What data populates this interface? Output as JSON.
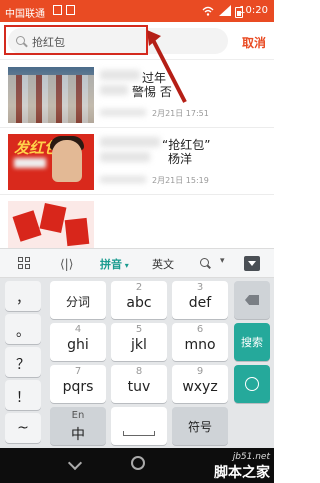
{
  "status_bar": {
    "carrier": "中国联通",
    "time": "10:20"
  },
  "search": {
    "placeholder": "抢红包",
    "cancel_label": "取消"
  },
  "results": [
    {
      "title": "过年",
      "subtitle": "警惕 否",
      "meta": "2月21日 17:51"
    },
    {
      "title": "“抢红包”",
      "subtitle": "杨洋",
      "meta": "2月21日 15:19"
    },
    {
      "title": "",
      "subtitle": "",
      "meta": ""
    }
  ],
  "kb_toolbar": {
    "pinyin_label": "拼音",
    "english_label": "英文"
  },
  "keyboard": {
    "punct_keys": [
      "，",
      "。",
      "？",
      "！",
      "~"
    ],
    "row1": [
      {
        "main": "分词"
      },
      {
        "main": "abc",
        "small": "2"
      },
      {
        "main": "def",
        "small": "3"
      }
    ],
    "row2": [
      {
        "main": "ghi",
        "small": "4"
      },
      {
        "main": "jkl",
        "small": "5"
      },
      {
        "main": "mno",
        "small": "6"
      }
    ],
    "row3": [
      {
        "main": "pqrs",
        "small": "7"
      },
      {
        "main": "tuv",
        "small": "8"
      },
      {
        "main": "wxyz",
        "small": "9"
      }
    ],
    "search_key": "搜索",
    "row4": {
      "lang_small": "En",
      "lang_main": "中",
      "symbols_label": "符号"
    }
  },
  "watermark": {
    "url": "jb51.net",
    "name": "脚本之家"
  },
  "colors": {
    "accent": "#e94b23",
    "keyboard_teal": "#25a99b",
    "annotation_red": "#d42a1e"
  }
}
